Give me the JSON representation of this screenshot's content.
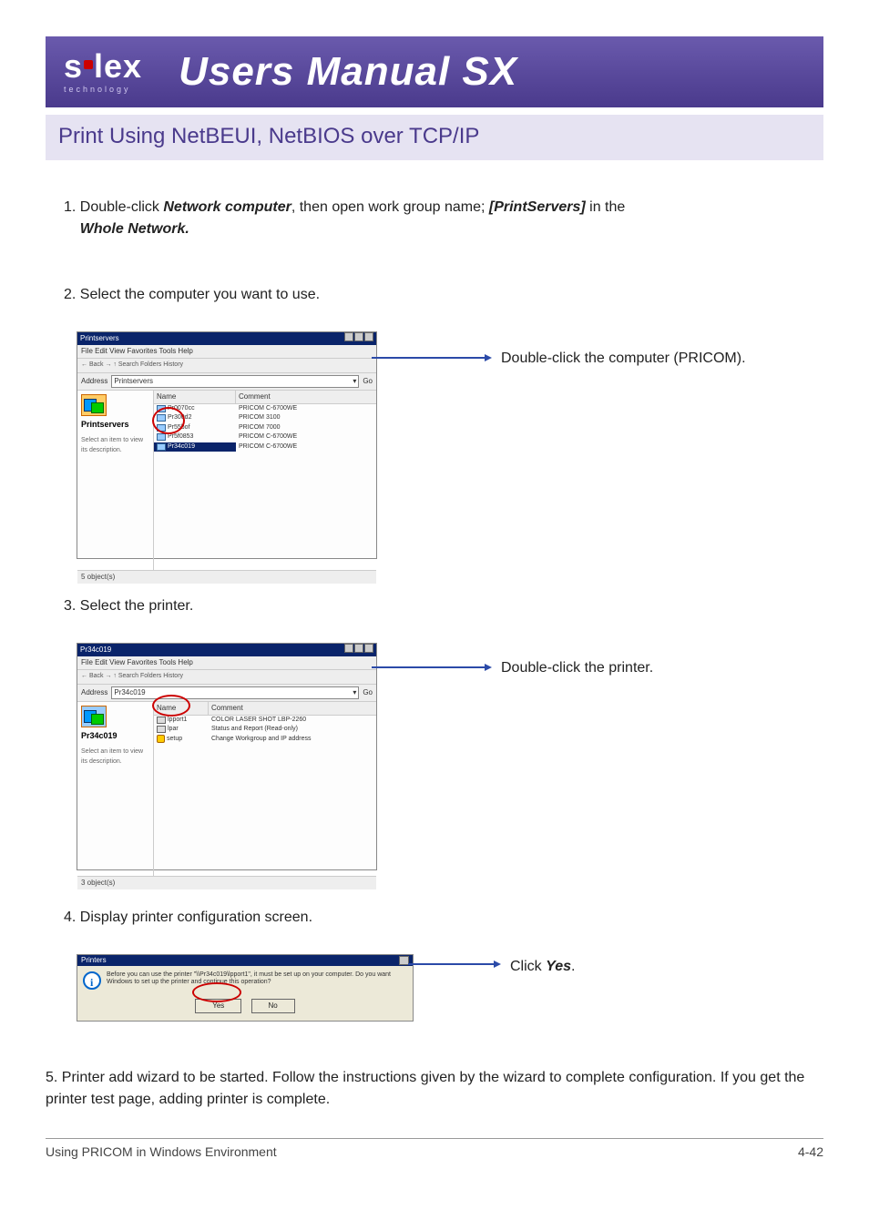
{
  "header": {
    "logo_main_left": "s",
    "logo_main_right": "lex",
    "logo_sub": "technology",
    "title": "Users Manual SX"
  },
  "section_title": "Print Using NetBEUI, NetBIOS over TCP/IP",
  "steps": {
    "s1_prefix": "1. Double-click ",
    "s1_bold1": "Network computer",
    "s1_mid": ", then open work group name; ",
    "s1_bold2": "[PrintServers]",
    "s1_mid2": " in the ",
    "s1_bold3": "Whole Network.",
    "s2": "2. Select the computer you want to use.",
    "s3": "3. Select the printer.",
    "s4": "4. Display printer configuration screen.",
    "s5": "5. Printer add wizard to be started. Follow the instructions given by the wizard to complete configuration. If you get the printer test page, adding printer is complete."
  },
  "callouts": {
    "c2": "Double-click the computer (PRICOM).",
    "c3": "Double-click the printer.",
    "c4_pre": "Click ",
    "c4_em": "Yes",
    "c4_post": "."
  },
  "ss1": {
    "title": "Printservers",
    "menu": "File   Edit   View   Favorites   Tools   Help",
    "toolbar": "← Back  →  ↑   Search   Folders   History",
    "addr_label": "Address",
    "addr_value": "Printservers",
    "go": "Go",
    "left_name": "Printservers",
    "left_desc": "Select an item to view its description.",
    "cols": {
      "name": "Name",
      "comment": "Comment"
    },
    "rows": [
      {
        "name": "Pr0070cc",
        "comment": "PRICOM C-6700WE"
      },
      {
        "name": "Pr300d2",
        "comment": "PRICOM 3100"
      },
      {
        "name": "Pr55bof",
        "comment": "PRICOM 7000"
      },
      {
        "name": "Pr5f0853",
        "comment": "PRICOM C-6700WE"
      },
      {
        "name": "Pr34c019",
        "comment": "PRICOM C-6700WE"
      }
    ],
    "status": "5 object(s)"
  },
  "ss2": {
    "title": "Pr34c019",
    "menu": "File   Edit   View   Favorites   Tools   Help",
    "toolbar": "← Back  →  ↑   Search   Folders   History",
    "addr_label": "Address",
    "addr_value": "Pr34c019",
    "go": "Go",
    "left_name": "Pr34c019",
    "left_desc": "Select an item to view its description.",
    "cols": {
      "name": "Name",
      "comment": "Comment"
    },
    "rows": [
      {
        "name": "lpport1",
        "comment": "COLOR LASER SHOT LBP-2260",
        "icon": "prn"
      },
      {
        "name": "lpar",
        "comment": "Status and Report (Read-only)",
        "icon": "prn"
      },
      {
        "name": "setup",
        "comment": "Change Workgroup and IP address",
        "icon": "cfg"
      }
    ],
    "status": "3 object(s)"
  },
  "dlg": {
    "title": "Printers",
    "msg": "Before you can use the printer \"\\\\Pr34c019\\lpport1\", it must be set up on your computer. Do you want Windows to set up the printer and continue this operation?",
    "yes": "Yes",
    "no": "No"
  },
  "footer": {
    "left": "Using PRICOM in Windows Environment",
    "right": "4-42"
  }
}
